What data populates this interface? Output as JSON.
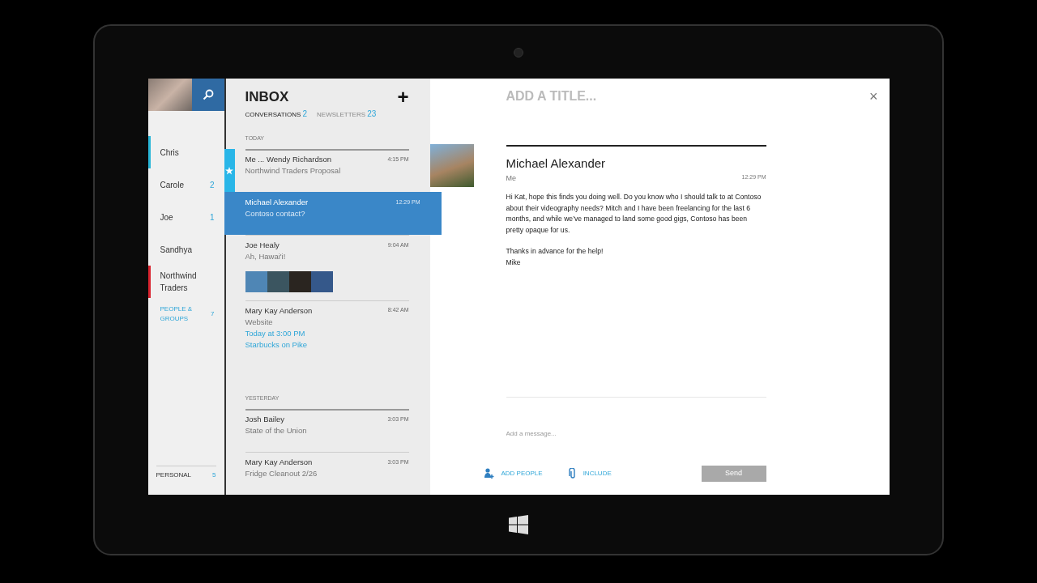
{
  "sidebar": {
    "items": [
      {
        "label": "Chris",
        "color": "#29b6d8",
        "kind": "person"
      },
      {
        "label": "Carole",
        "count": "2",
        "kind": "person"
      },
      {
        "label": "Joe",
        "count": "1",
        "kind": "person"
      },
      {
        "label": "Sandhya",
        "kind": "person"
      },
      {
        "label": "Northwind Traders",
        "color": "#d9232e",
        "kind": "person"
      },
      {
        "label": "PEOPLE & GROUPS",
        "count": "7",
        "kind": "group"
      }
    ],
    "footer_item": {
      "label": "PERSONAL",
      "count": "5"
    }
  },
  "inbox": {
    "title": "INBOX",
    "add_button": "+",
    "tabs": [
      {
        "label": "CONVERSATIONS",
        "count": "2",
        "selected": true
      },
      {
        "label": "NEWSLETTERS",
        "count": "23",
        "selected": false
      }
    ],
    "groups": [
      {
        "label": "TODAY",
        "messages": [
          {
            "sender": "Me ... Wendy Richardson",
            "time": "4:15 PM",
            "subject": "Northwind Traders Proposal",
            "starred": true,
            "selected": false
          },
          {
            "sender": "Michael Alexander",
            "time": "12:29 PM",
            "subject": "Contoso contact?",
            "starred": false,
            "selected": true
          },
          {
            "sender": "Joe Healy",
            "time": "9:04 AM",
            "subject": "Ah, Hawai'i!",
            "starred": false,
            "selected": false,
            "attachments": [
              {
                "kind": "photo"
              },
              {
                "kind": "photo"
              },
              {
                "kind": "photo"
              },
              {
                "kind": "photo"
              }
            ]
          },
          {
            "sender": "Mary Kay Anderson",
            "time": "8:42 AM",
            "subject": "Website",
            "starred": false,
            "selected": false,
            "details": [
              "Today at 3:00 PM",
              "Starbucks on Pike"
            ]
          }
        ]
      },
      {
        "label": "YESTERDAY",
        "messages": [
          {
            "sender": "Josh Bailey",
            "time": "3:03 PM",
            "subject": "State of the Union",
            "starred": false,
            "selected": false
          },
          {
            "sender": "Mary Kay Anderson",
            "time": "3:03 PM",
            "subject": "Fridge Cleanout 2/26",
            "starred": false,
            "selected": false
          }
        ]
      }
    ]
  },
  "detail": {
    "title_placeholder": "ADD A TITLE...",
    "close": "×",
    "message": {
      "sender": "Michael Alexander",
      "to": "Me",
      "time": "12:29 PM",
      "body": [
        "Hi Kat, hope this finds you doing well.  Do you know who I should talk to at Contoso about their videography needs?  Mitch and I have been freelancing for the last 6 months, and while we’ve managed to land some good gigs, Contoso has been pretty opaque for us.",
        "Thanks in advance for the help!\nMike"
      ]
    },
    "reply_placeholder": "Add a message...",
    "actions": [
      {
        "label": "ADD PEOPLE",
        "kind": "people"
      },
      {
        "label": "INCLUDE",
        "kind": "attach"
      }
    ],
    "send": {
      "label": "Send",
      "disabled": true
    }
  }
}
